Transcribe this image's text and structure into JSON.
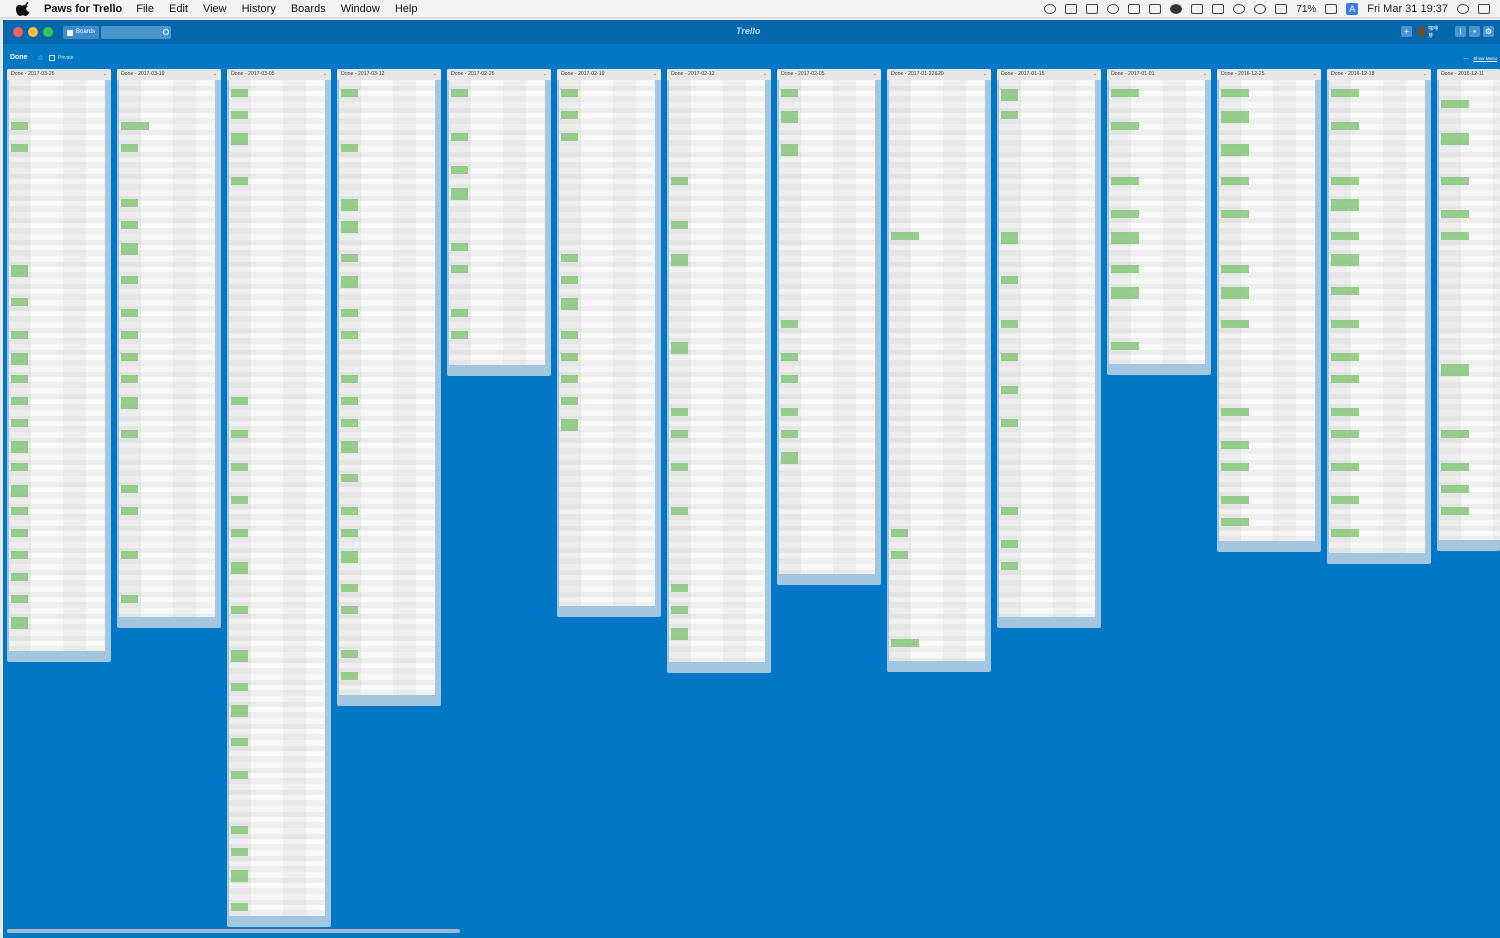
{
  "menubar": {
    "app_name": "Paws for Trello",
    "menus": [
      "File",
      "Edit",
      "View",
      "History",
      "Boards",
      "Window",
      "Help"
    ],
    "battery": "71%",
    "input_source": "A",
    "clock": "Fri Mar 31  19:37"
  },
  "window": {
    "boards_button": "Boards",
    "logo": "Trello",
    "add_button": "+",
    "user_initials": "咖啡芽"
  },
  "board": {
    "title": "Done",
    "privacy": "Private",
    "show_menu": "Show Menu",
    "menu_dots": "…"
  },
  "lists": [
    {
      "title": "Done - 2017-03-26"
    },
    {
      "title": "Done - 2017-03-19"
    },
    {
      "title": "Done - 2017-03-05"
    },
    {
      "title": "Done - 2017-03-12"
    },
    {
      "title": "Done - 2017-02-26"
    },
    {
      "title": "Done - 2017-02-19"
    },
    {
      "title": "Done - 2017-02-12"
    },
    {
      "title": "Done - 2017-02-05"
    },
    {
      "title": "Done - 2017-01-22&29"
    },
    {
      "title": "Done - 2017-01-15"
    },
    {
      "title": "Done - 2017-01-01"
    },
    {
      "title": "Done - 2016-12-25"
    },
    {
      "title": "Done - 2016-12-18"
    },
    {
      "title": "Done - 2016-12-11"
    }
  ],
  "colors": {
    "board_background": "#0277c6",
    "list_background": "#a3c6e0",
    "label_green": "#86c57a"
  }
}
